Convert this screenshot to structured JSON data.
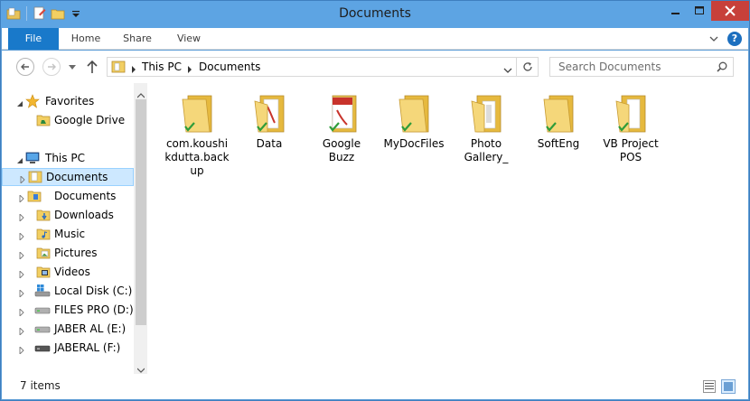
{
  "window": {
    "title": "Documents",
    "accent": "#5da4e3",
    "close_color": "#c7403a"
  },
  "ribbon": {
    "tabs": [
      {
        "label": "File"
      },
      {
        "label": "Home"
      },
      {
        "label": "Share"
      },
      {
        "label": "View"
      }
    ],
    "help_label": "?"
  },
  "address": {
    "crumbs": [
      "This PC",
      "Documents"
    ],
    "search_placeholder": "Search Documents"
  },
  "navpane": {
    "items": [
      {
        "label": "Favorites",
        "icon": "star-icon"
      },
      {
        "label": "Google Drive",
        "icon": "google-drive-folder-icon"
      },
      {
        "label": "This PC",
        "icon": "computer-icon"
      },
      {
        "label": "Documents",
        "icon": "documents-library-icon",
        "selected": true
      },
      {
        "label": "Documents",
        "icon": "documents-folder-icon"
      },
      {
        "label": "Downloads",
        "icon": "downloads-folder-icon"
      },
      {
        "label": "Music",
        "icon": "music-folder-icon"
      },
      {
        "label": "Pictures",
        "icon": "pictures-folder-icon"
      },
      {
        "label": "Videos",
        "icon": "videos-folder-icon"
      },
      {
        "label": "Local Disk (C:)",
        "icon": "system-drive-icon"
      },
      {
        "label": "FILES PRO (D:)",
        "icon": "drive-icon"
      },
      {
        "label": "JABER AL (E:)",
        "icon": "drive-icon"
      },
      {
        "label": "JABERAL (F:)",
        "icon": "drive-icon"
      }
    ]
  },
  "files": [
    {
      "name": "com.koushikdutta.backup",
      "icon": "synced-folder-icon"
    },
    {
      "name": "Data",
      "icon": "pdf-folder-icon"
    },
    {
      "name": "Google Buzz",
      "icon": "pdf-folder-icon"
    },
    {
      "name": "MyDocFiles",
      "icon": "synced-folder-icon"
    },
    {
      "name": "Photo Gallery_",
      "icon": "folder-icon"
    },
    {
      "name": "SoftEng",
      "icon": "synced-folder-icon"
    },
    {
      "name": "VB Project POS",
      "icon": "synced-folder-icon"
    }
  ],
  "status": {
    "count_text": "7 items"
  }
}
